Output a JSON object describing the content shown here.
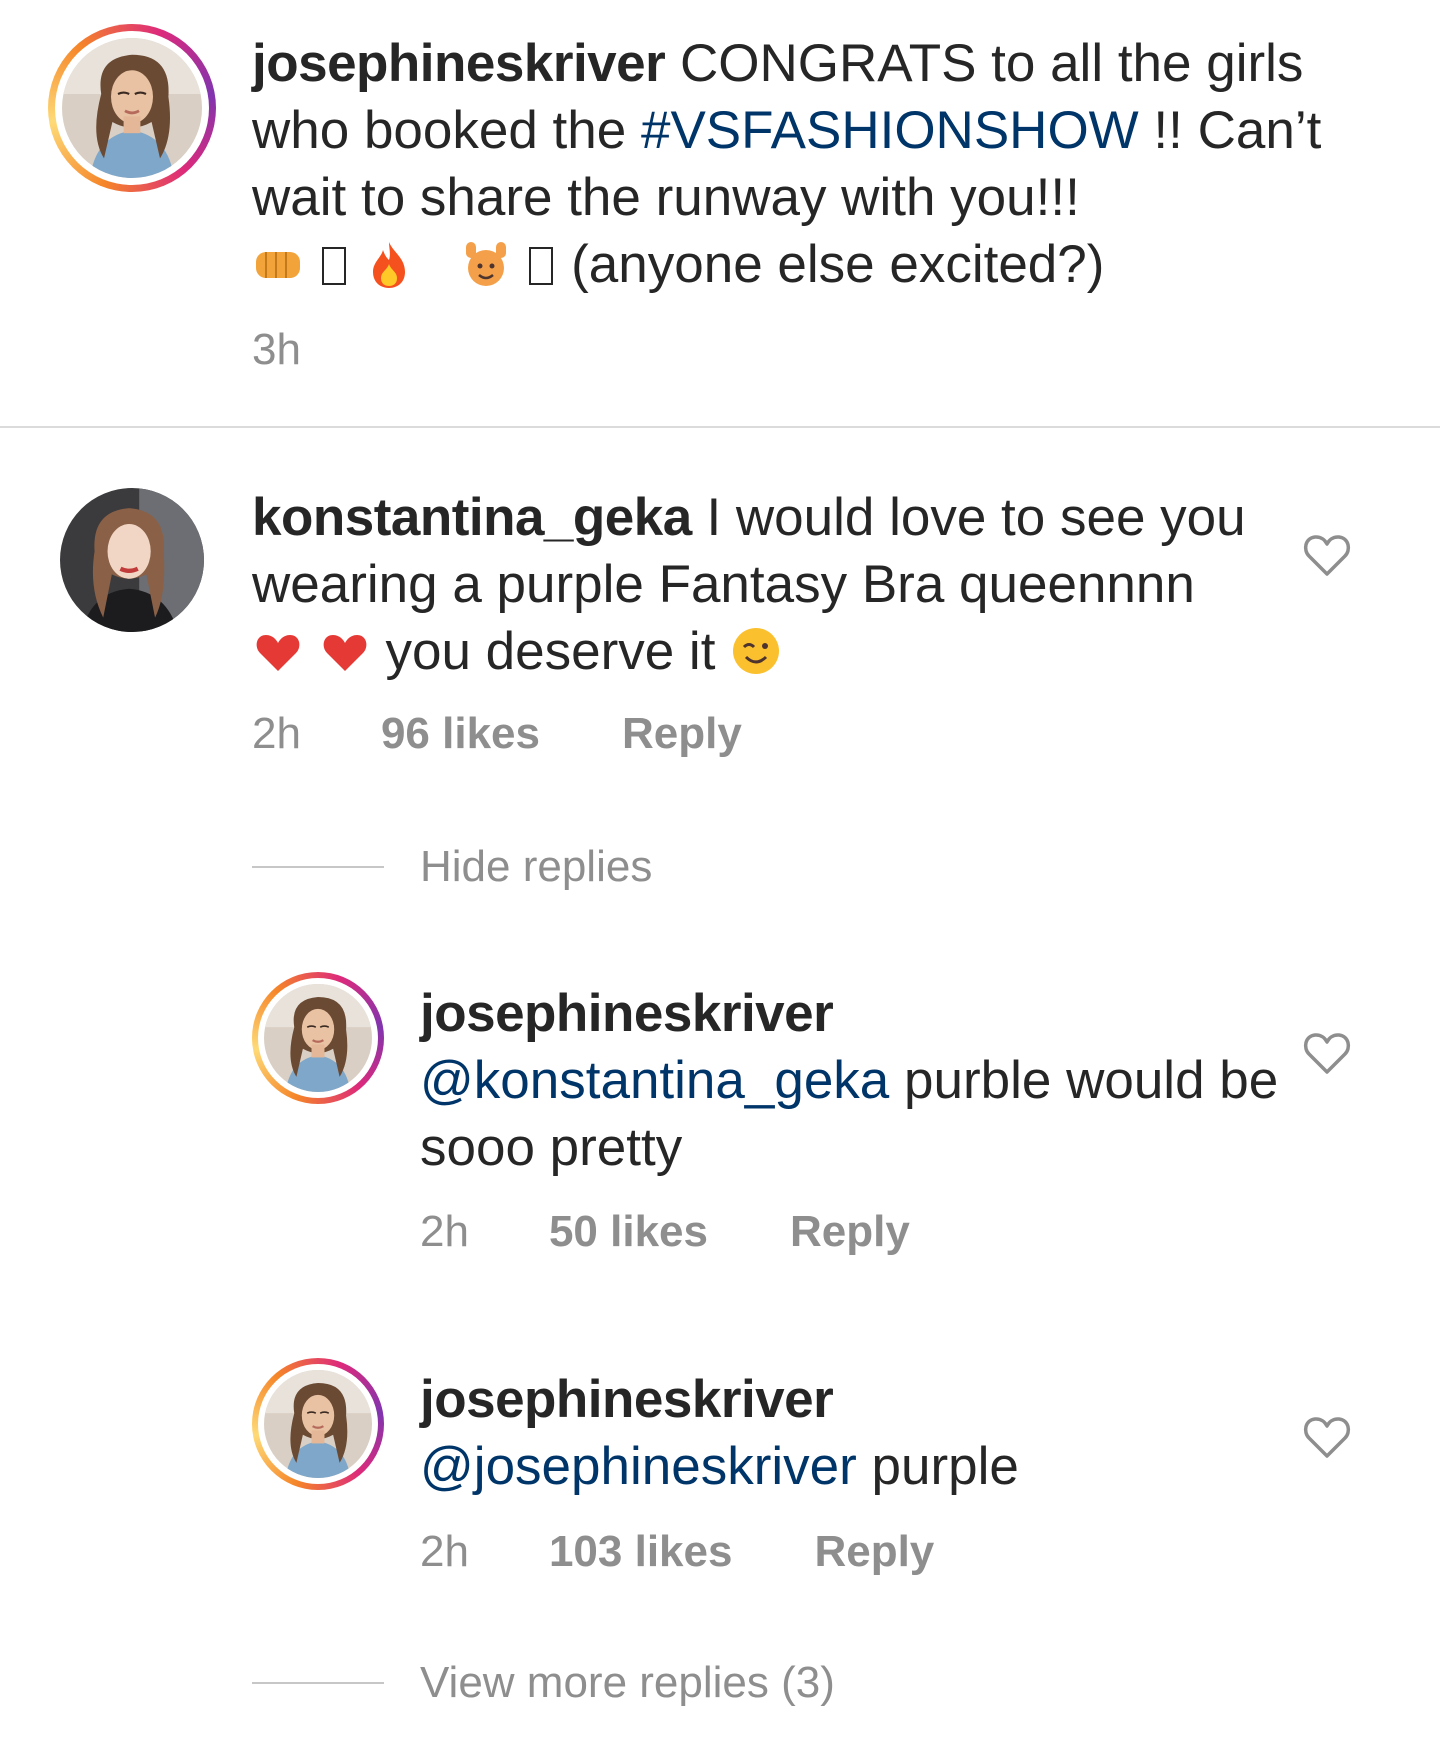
{
  "caption": {
    "username": "josephineskriver",
    "text_before_tag": "CONGRATS to all the girls who booked the",
    "hashtag": "#VSFASHIONSHOW",
    "text_after_tag": "!! Can’t wait to share the runway with you!!!",
    "emoji_tail": "(anyone else excited?)",
    "time": "3h"
  },
  "comment": {
    "username": "konstantina_geka",
    "text_part1": "I would love to see you wearing a purple Fantasy Bra queennnn",
    "text_part2": "you deserve it",
    "time": "2h",
    "likes": "96 likes",
    "reply_label": "Reply"
  },
  "hide_replies": "Hide replies",
  "replies": [
    {
      "username": "josephineskriver",
      "mention": "@konstantina_geka",
      "text": "purble would be sooo pretty",
      "time": "2h",
      "likes": "50 likes",
      "reply_label": "Reply"
    },
    {
      "username": "josephineskriver",
      "mention": "@josephineskriver",
      "text": "purple",
      "time": "2h",
      "likes": "103 likes",
      "reply_label": "Reply"
    }
  ],
  "view_more_replies": "View more replies (3)",
  "icons": {
    "like": "heart-outline-icon"
  },
  "colors": {
    "text": "#262626",
    "muted": "#8e8e8e",
    "link": "#003569",
    "divider": "#dbdbdb"
  }
}
